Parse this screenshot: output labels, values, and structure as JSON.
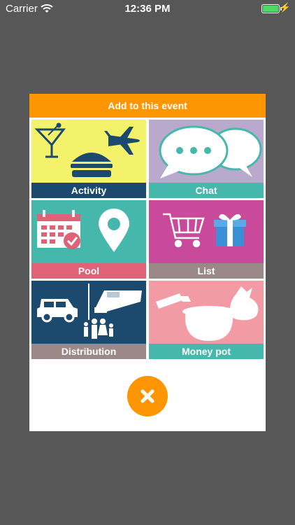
{
  "status_bar": {
    "carrier": "Carrier",
    "time": "12:36 PM",
    "battery_color": "#4cd964"
  },
  "dialog": {
    "title": "Add to this event",
    "header_color": "#fe9603",
    "tiles": [
      {
        "label": "Activity",
        "art_color": "#f3f26a",
        "label_color": "#1c4a6e",
        "icons": [
          "cocktail-icon",
          "burger-icon",
          "airplane-icon"
        ]
      },
      {
        "label": "Chat",
        "art_color": "#b9a9cc",
        "label_color": "#45b7ab",
        "icons": [
          "speech-bubbles-icon"
        ]
      },
      {
        "label": "Pool",
        "art_color": "#45b7ab",
        "label_color": "#e06277",
        "icons": [
          "calendar-icon",
          "location-pin-icon"
        ]
      },
      {
        "label": "List",
        "art_color": "#c9499a",
        "label_color": "#9b8988",
        "icons": [
          "shopping-cart-icon",
          "gift-icon"
        ]
      },
      {
        "label": "Distribution",
        "art_color": "#1c4a6e",
        "label_color": "#9b8988",
        "icons": [
          "car-icon",
          "bed-icon",
          "family-icon"
        ]
      },
      {
        "label": "Money pot",
        "art_color": "#f29ba4",
        "label_color": "#45b7ab",
        "icons": [
          "banknote-icon",
          "pot-icon",
          "money-bag-icon"
        ]
      }
    ],
    "close_icon": "close-icon"
  }
}
